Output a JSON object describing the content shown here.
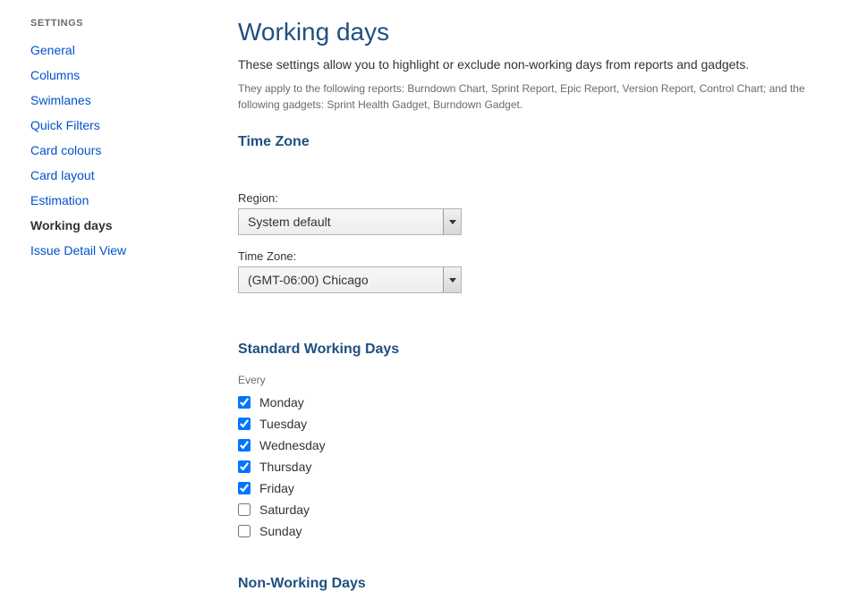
{
  "sidebar": {
    "heading": "SETTINGS",
    "items": [
      {
        "label": "General",
        "active": false
      },
      {
        "label": "Columns",
        "active": false
      },
      {
        "label": "Swimlanes",
        "active": false
      },
      {
        "label": "Quick Filters",
        "active": false
      },
      {
        "label": "Card colours",
        "active": false
      },
      {
        "label": "Card layout",
        "active": false
      },
      {
        "label": "Estimation",
        "active": false
      },
      {
        "label": "Working days",
        "active": true
      },
      {
        "label": "Issue Detail View",
        "active": false
      }
    ]
  },
  "main": {
    "title": "Working days",
    "description": "These settings allow you to highlight or exclude non-working days from reports and gadgets.",
    "sub_description": "They apply to the following reports: Burndown Chart, Sprint Report, Epic Report, Version Report, Control Chart; and the following gadgets: Sprint Health Gadget, Burndown Gadget.",
    "timezone_section": {
      "heading": "Time Zone",
      "region": {
        "label": "Region:",
        "value": "System default"
      },
      "timezone": {
        "label": "Time Zone:",
        "value": "(GMT-06:00) Chicago"
      }
    },
    "working_days_section": {
      "heading": "Standard Working Days",
      "sub_label": "Every",
      "days": [
        {
          "label": "Monday",
          "checked": true
        },
        {
          "label": "Tuesday",
          "checked": true
        },
        {
          "label": "Wednesday",
          "checked": true
        },
        {
          "label": "Thursday",
          "checked": true
        },
        {
          "label": "Friday",
          "checked": true
        },
        {
          "label": "Saturday",
          "checked": false
        },
        {
          "label": "Sunday",
          "checked": false
        }
      ]
    },
    "non_working_section": {
      "heading": "Non-Working Days"
    }
  }
}
